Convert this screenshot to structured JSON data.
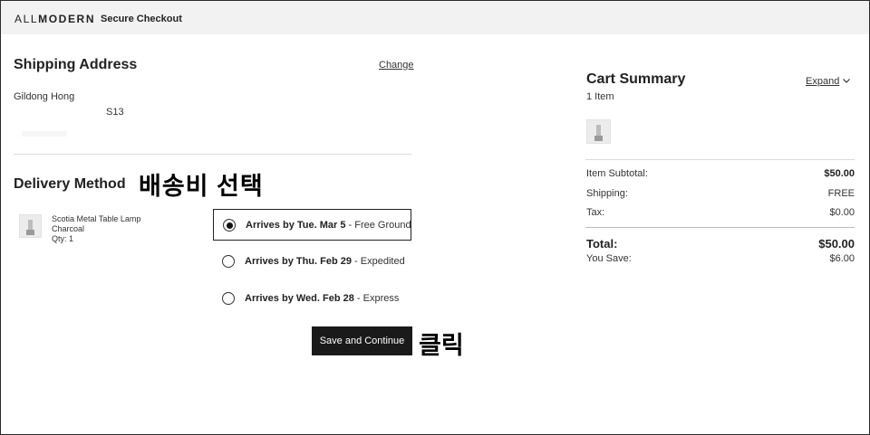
{
  "header": {
    "logo_light": "ALL",
    "logo_bold": "MODERN",
    "secure_label": "Secure Checkout"
  },
  "shipping": {
    "title": "Shipping Address",
    "change_label": "Change",
    "name": "Gildong Hong",
    "address_fragment": "S13"
  },
  "delivery": {
    "title": "Delivery Method",
    "annotation": "배송비 선택",
    "product": {
      "name": "Scotia Metal Table Lamp",
      "color": "Charcoal",
      "qty": "Qty: 1"
    },
    "options": [
      {
        "date": "Arrives by Tue. Mar 5",
        "method": " - Free Ground",
        "selected": true
      },
      {
        "date": "Arrives by Thu. Feb 29",
        "method": " - Expedited",
        "selected": false
      },
      {
        "date": "Arrives by Wed. Feb 28",
        "method": " - Express",
        "selected": false
      }
    ],
    "save_label": "Save and Continue",
    "click_annotation": "클릭"
  },
  "cart": {
    "title": "Cart Summary",
    "expand_label": "Expand",
    "items_count": "1 Item",
    "subtotal_label": "Item Subtotal:",
    "subtotal_value": "$50.00",
    "shipping_label": "Shipping:",
    "shipping_value": "FREE",
    "tax_label": "Tax:",
    "tax_value": "$0.00",
    "total_label": "Total:",
    "total_value": "$50.00",
    "save_label": "You Save:",
    "save_value": "$6.00"
  }
}
